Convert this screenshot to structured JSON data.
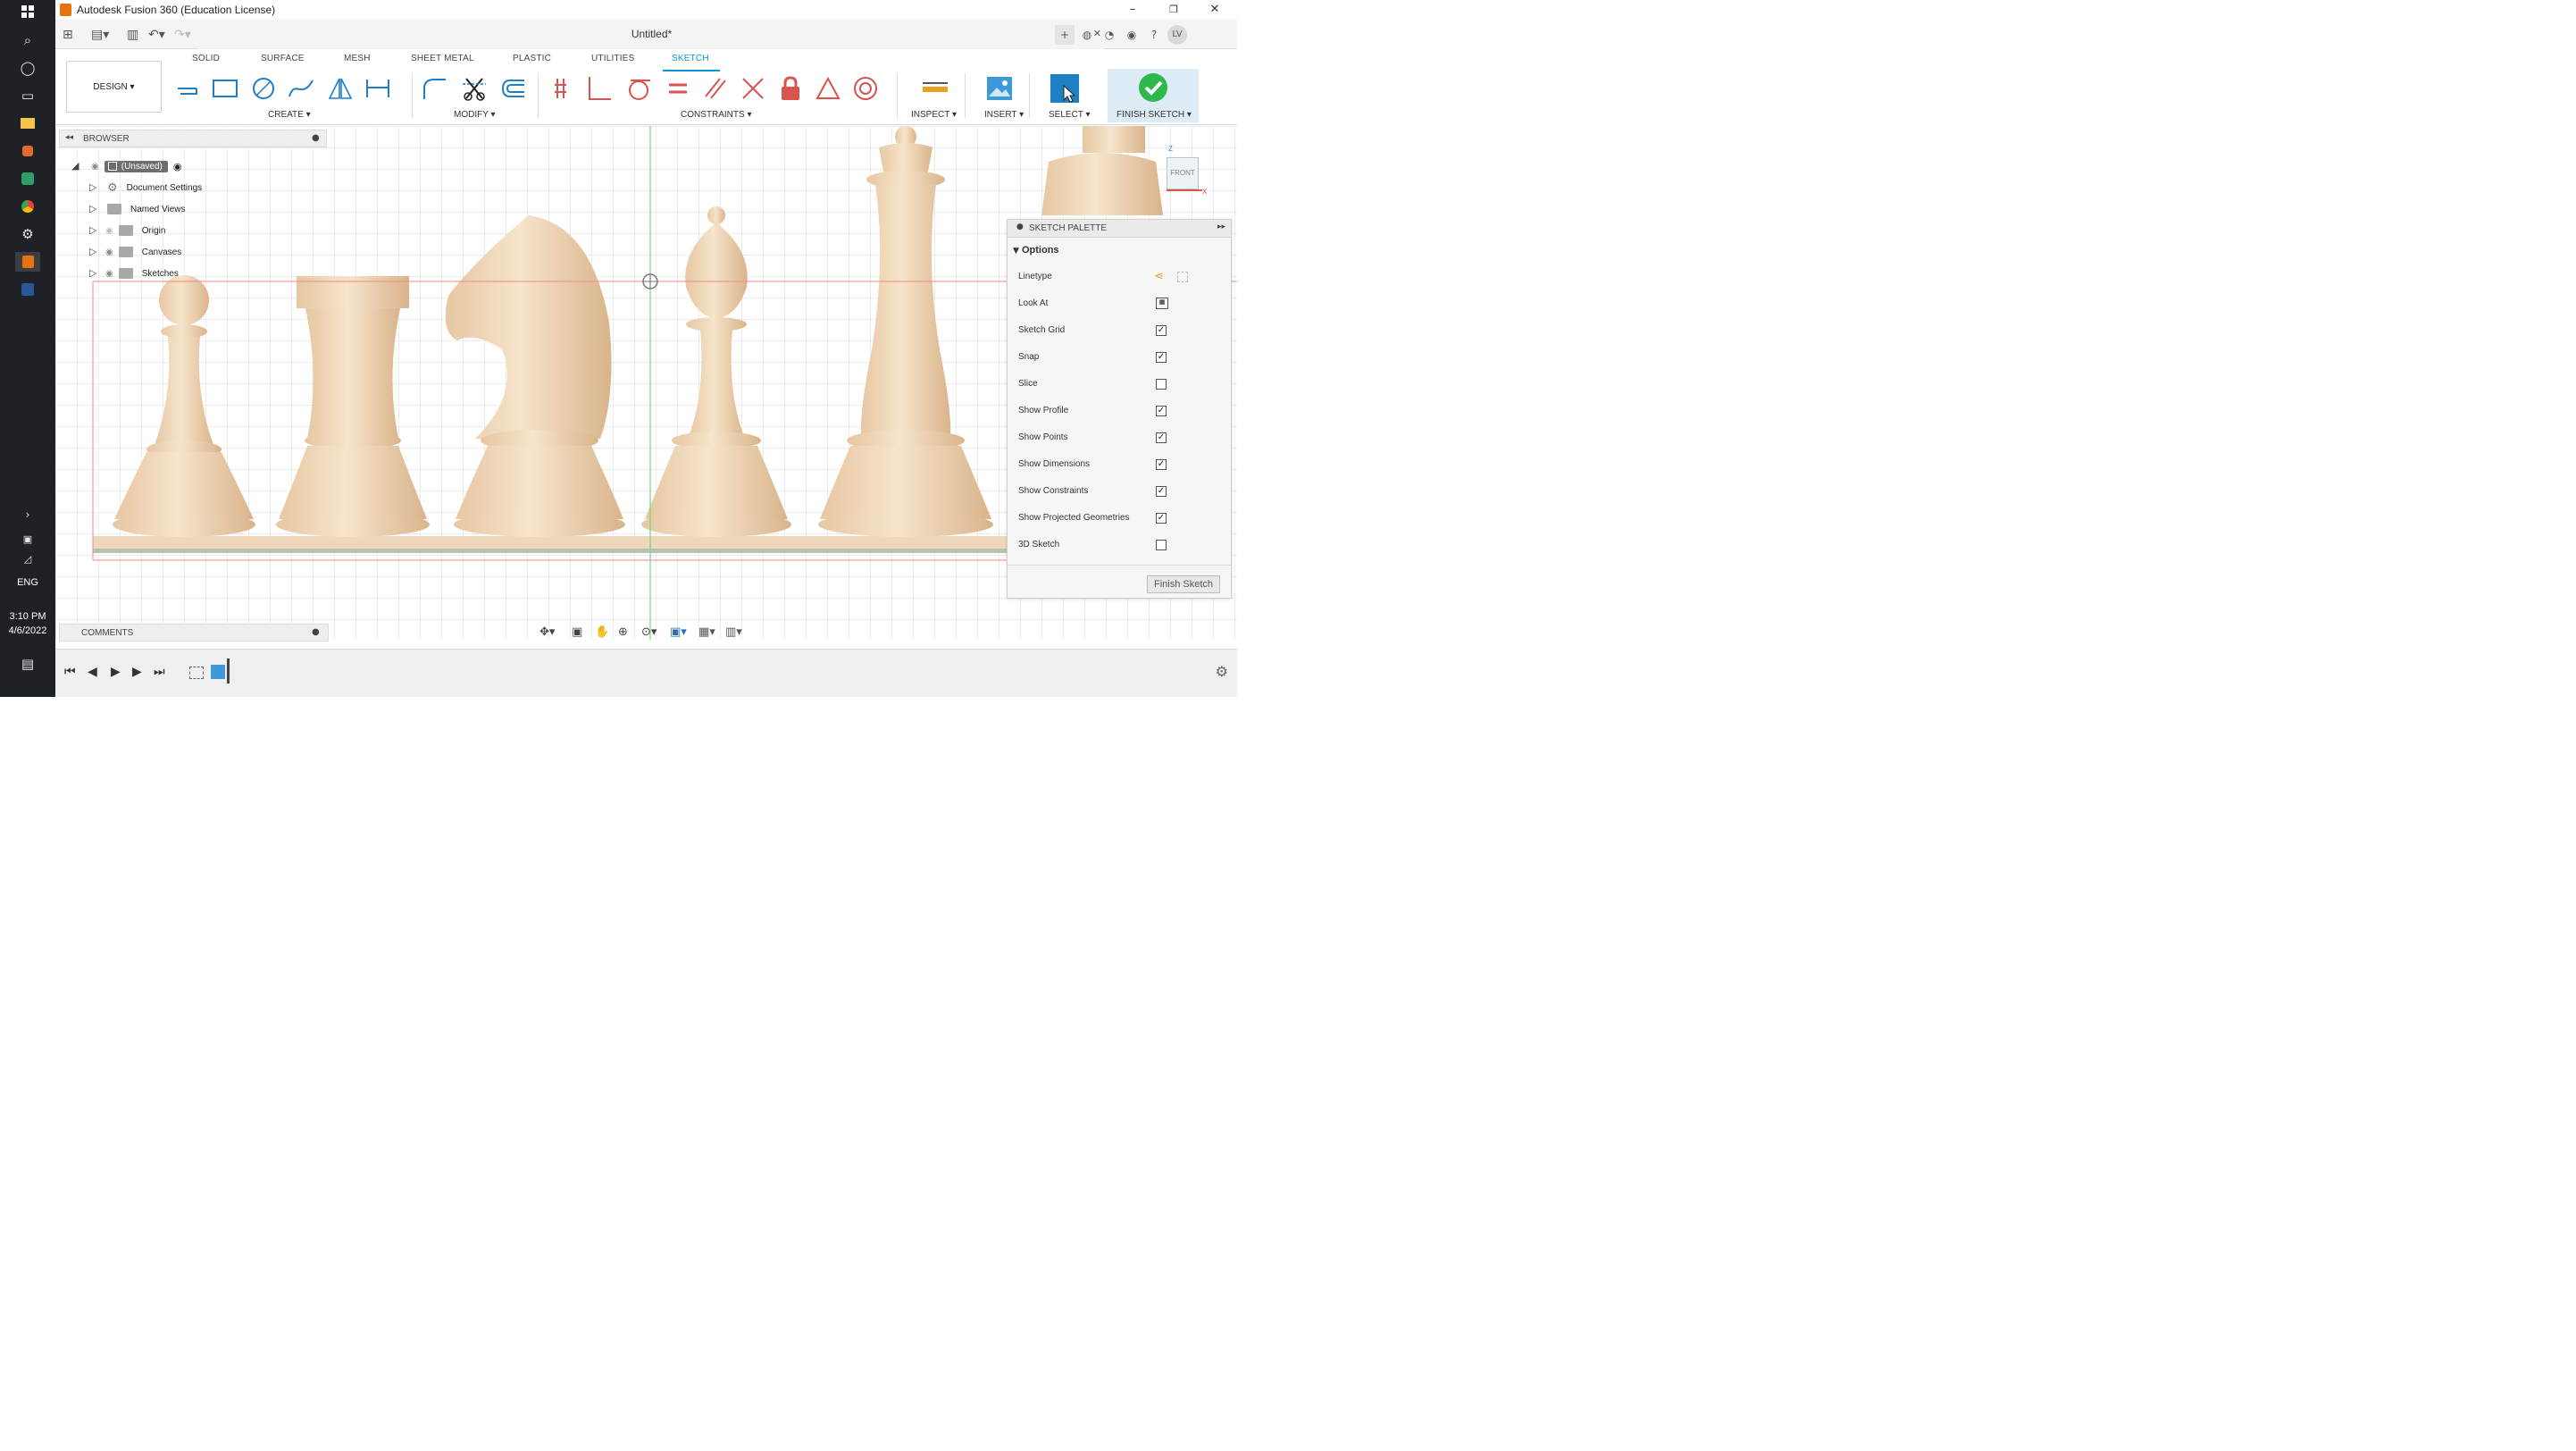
{
  "window": {
    "title": "Autodesk Fusion 360 (Education License)",
    "minimize": "–",
    "restore": "❐",
    "close": "✕"
  },
  "document": {
    "name": "Untitled*",
    "user_initials": "LV"
  },
  "taskbar": {
    "language": "ENG",
    "time": "3:10 PM",
    "date": "4/6/2022"
  },
  "workspace_tabs": [
    "SOLID",
    "SURFACE",
    "MESH",
    "SHEET METAL",
    "PLASTIC",
    "UTILITIES",
    "SKETCH"
  ],
  "active_tab": "SKETCH",
  "design_button": "DESIGN ▾",
  "tool_groups": {
    "create": "CREATE ▾",
    "modify": "MODIFY ▾",
    "constraints": "CONSTRAINTS ▾",
    "inspect": "INSPECT ▾",
    "insert": "INSERT ▾",
    "select": "SELECT ▾",
    "finish_sketch": "FINISH SKETCH ▾"
  },
  "browser": {
    "title": "BROWSER",
    "root": "(Unsaved)",
    "items": [
      {
        "label": "Document Settings",
        "icon": "gear-icon"
      },
      {
        "label": "Named Views",
        "icon": "folder-icon"
      },
      {
        "label": "Origin",
        "icon": "folder-icon"
      },
      {
        "label": "Canvases",
        "icon": "folder-icon"
      },
      {
        "label": "Sketches",
        "icon": "folder-icon"
      }
    ]
  },
  "comments": {
    "title": "COMMENTS"
  },
  "viewcube": {
    "face": "FRONT",
    "axis_z": "Z",
    "axis_x": "X"
  },
  "sketch_palette": {
    "title": "SKETCH PALETTE",
    "section": "Options",
    "rows": [
      {
        "label": "Linetype",
        "type": "icons"
      },
      {
        "label": "Look At",
        "type": "button"
      },
      {
        "label": "Sketch Grid",
        "checked": true
      },
      {
        "label": "Snap",
        "checked": true
      },
      {
        "label": "Slice",
        "checked": false
      },
      {
        "label": "Show Profile",
        "checked": true
      },
      {
        "label": "Show Points",
        "checked": true
      },
      {
        "label": "Show Dimensions",
        "checked": true
      },
      {
        "label": "Show Constraints",
        "checked": true
      },
      {
        "label": "Show Projected Geometries",
        "checked": true
      },
      {
        "label": "3D Sketch",
        "checked": false
      }
    ],
    "finish_button": "Finish Sketch"
  },
  "colors": {
    "accent": "#0696d7",
    "finish_green": "#2eb84b",
    "constraint_red": "#d9534f",
    "wood": "#f2dcc0",
    "taskbar": "#1e2126"
  }
}
